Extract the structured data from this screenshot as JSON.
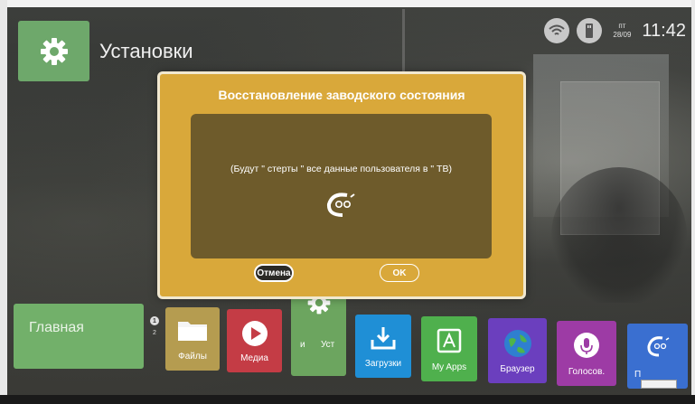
{
  "header": {
    "title": "Установки",
    "icon": "gear-icon"
  },
  "status_bar": {
    "wifi_icon": "wifi-icon",
    "usb_icon": "usb-icon",
    "weekday": "пт",
    "date": "28/09",
    "time": "11:42"
  },
  "dialog": {
    "title": "Восстановление заводского состояния",
    "message": "(Будут \" стерты \" все данные пользователя в \" ТВ)",
    "logo_icon": "brand-logo-icon",
    "cancel_label": "Отмена",
    "ok_label": "OK"
  },
  "pager": {
    "current": "1",
    "next": "2"
  },
  "tiles": {
    "home": "Главная",
    "files": "Файлы",
    "media": "Медиа",
    "settings_left": "и",
    "settings_right": "Уст",
    "downloads": "Загрузки",
    "myapps": "My Apps",
    "browser": "Браузер",
    "voice": "Голосов.",
    "tv": "П"
  },
  "colors": {
    "dialog_bg": "#d9a83a",
    "dialog_inner": "#6e5b2b",
    "home_tile": "#72b06a",
    "media_tile": "#c43c45",
    "downloads_tile": "#1f8fd6",
    "myapps_tile": "#4fb04d",
    "browser_tile": "#6b3fbe",
    "voice_tile": "#9d3ba5",
    "tv_tile": "#3a6fd0"
  }
}
